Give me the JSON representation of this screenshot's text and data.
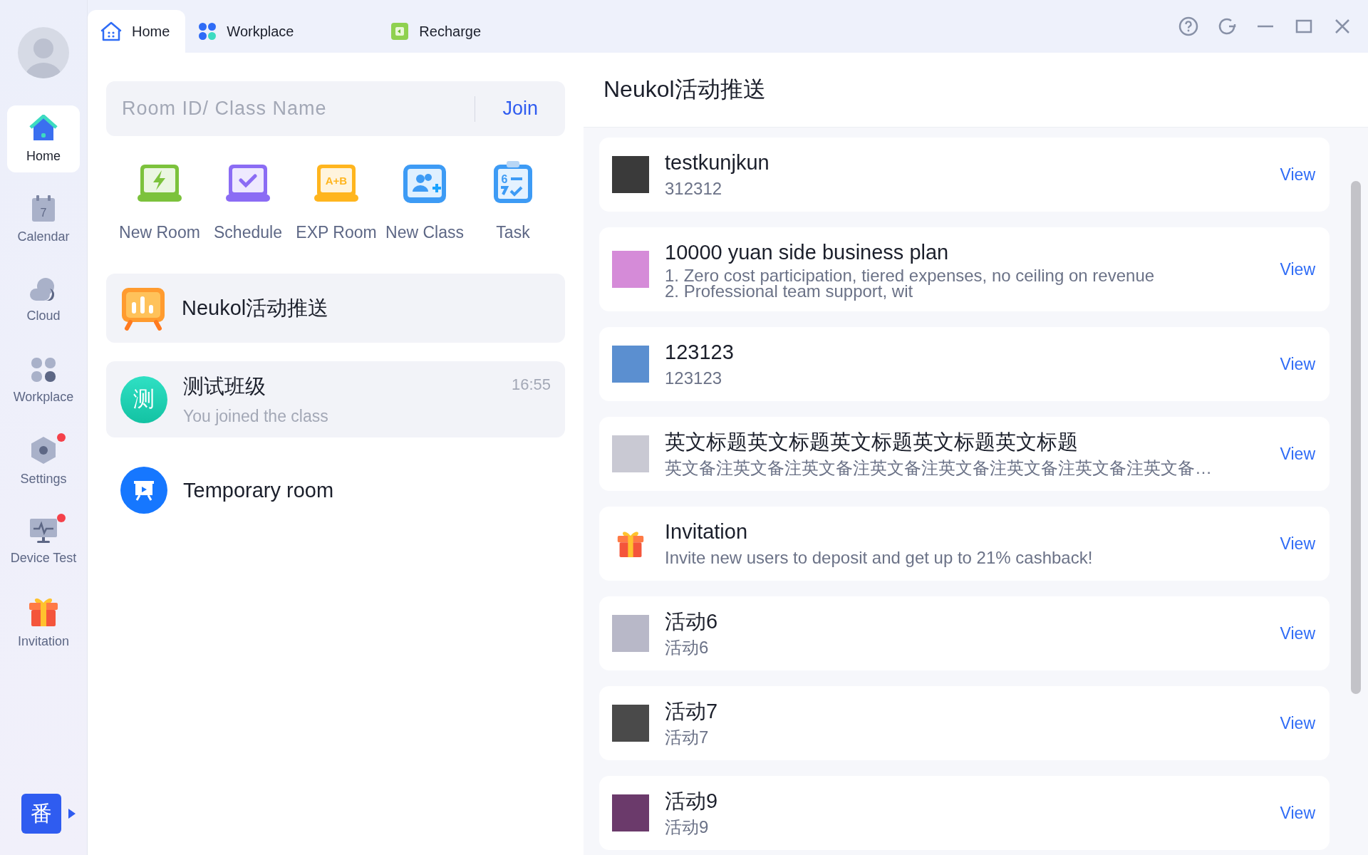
{
  "sidebar": {
    "items": [
      {
        "label": "Home",
        "selected": true,
        "badge": false
      },
      {
        "label": "Calendar",
        "selected": false,
        "badge": false,
        "glyph": "7"
      },
      {
        "label": "Cloud",
        "selected": false,
        "badge": false
      },
      {
        "label": "Workplace",
        "selected": false,
        "badge": false
      },
      {
        "label": "Settings",
        "selected": false,
        "badge": true
      },
      {
        "label": "Device Test",
        "selected": false,
        "badge": true
      },
      {
        "label": "Invitation",
        "selected": false,
        "badge": false
      }
    ],
    "footer_button": "番"
  },
  "tabs": [
    {
      "label": "Home",
      "selected": true
    },
    {
      "label": "Workplace",
      "selected": false
    },
    {
      "label": "Recharge",
      "selected": false
    }
  ],
  "join": {
    "placeholder": "Room ID/ Class Name",
    "button": "Join"
  },
  "tools": [
    {
      "label": "New Room"
    },
    {
      "label": "Schedule"
    },
    {
      "label": "EXP Room",
      "glyph": "A+B"
    },
    {
      "label": "New Class"
    },
    {
      "label": "Task",
      "glyph": "6"
    }
  ],
  "conversations": [
    {
      "kind": "push",
      "title": "Neukol活动推送"
    },
    {
      "kind": "class",
      "title": "测试班级",
      "avatar_text": "测",
      "subtitle": "You joined the class",
      "time": "16:55"
    },
    {
      "kind": "temp",
      "title": "Temporary room"
    }
  ],
  "feed": {
    "title": "Neukol活动推送",
    "items": [
      {
        "kind": "photo",
        "title": "testkunjkun",
        "subtitle": "312312",
        "action": "View"
      },
      {
        "kind": "photo",
        "title": "10000 yuan side business plan",
        "subtitle": "1. Zero cost participation, tiered expenses, no ceiling on revenue\n2. Professional team support, wit",
        "action": "View"
      },
      {
        "kind": "photo",
        "title": "123123",
        "subtitle": "123123",
        "action": "View"
      },
      {
        "kind": "photo",
        "title": "英文标题英文标题英文标题英文标题英文标题",
        "subtitle": "英文备注英文备注英文备注英文备注英文备注英文备注英文备注英文备…",
        "action": "View"
      },
      {
        "kind": "gift",
        "title": "Invitation",
        "subtitle": "Invite new users to deposit and get up to 21% cashback!",
        "action": "View"
      },
      {
        "kind": "photo",
        "title": "活动6",
        "subtitle": "活动6",
        "action": "View"
      },
      {
        "kind": "photo",
        "title": "活动7",
        "subtitle": "活动7",
        "action": "View"
      },
      {
        "kind": "photo",
        "title": "活动9",
        "subtitle": "活动9",
        "action": "View"
      }
    ]
  }
}
